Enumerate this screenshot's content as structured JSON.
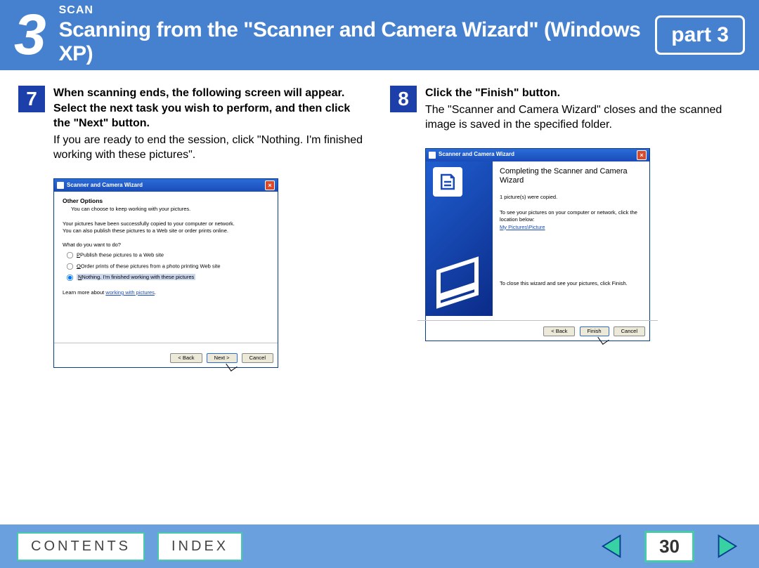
{
  "header": {
    "chapter_number": "3",
    "small": "SCAN",
    "title": "Scanning from the \"Scanner and Camera Wizard\" (Windows XP)",
    "part": "part 3"
  },
  "step7": {
    "num": "7",
    "title": "When scanning ends, the following screen will appear. Select the next task you wish to perform, and then click the \"Next\" button.",
    "desc": "If you are ready to end the session, click \"Nothing. I'm finished working with these pictures\".",
    "dialog": {
      "title": "Scanner and Camera Wizard",
      "heading": "Other Options",
      "heading_sub": "You can choose to keep working with your pictures.",
      "copied": "Your pictures have been successfully copied to your computer or network.",
      "copied2": "You can also publish these pictures to a Web site or order prints online.",
      "whatq": "What do you want to do?",
      "opt1": "Publish these pictures to a Web site",
      "opt2": "Order prints of these pictures from a photo printing Web site",
      "opt3": "Nothing. I'm finished working with these pictures",
      "learn": "Learn more about ",
      "learn_link": "working with pictures",
      "back": "< Back",
      "next": "Next >",
      "cancel": "Cancel"
    }
  },
  "step8": {
    "num": "8",
    "title": "Click the \"Finish\" button.",
    "desc": "The \"Scanner and Camera Wizard\" closes and the scanned image is saved in the specified folder.",
    "dialog": {
      "title": "Scanner and Camera Wizard",
      "complete": "Completing the Scanner and Camera Wizard",
      "copied": "1 picture(s) were copied.",
      "see": "To see your pictures on your computer or network, click the location below:",
      "link": "My Pictures\\Picture",
      "close": "To close this wizard and see your pictures, click Finish.",
      "back": "< Back",
      "finish": "Finish",
      "cancel": "Cancel"
    }
  },
  "footer": {
    "contents": "CONTENTS",
    "index": "INDEX",
    "page": "30"
  }
}
